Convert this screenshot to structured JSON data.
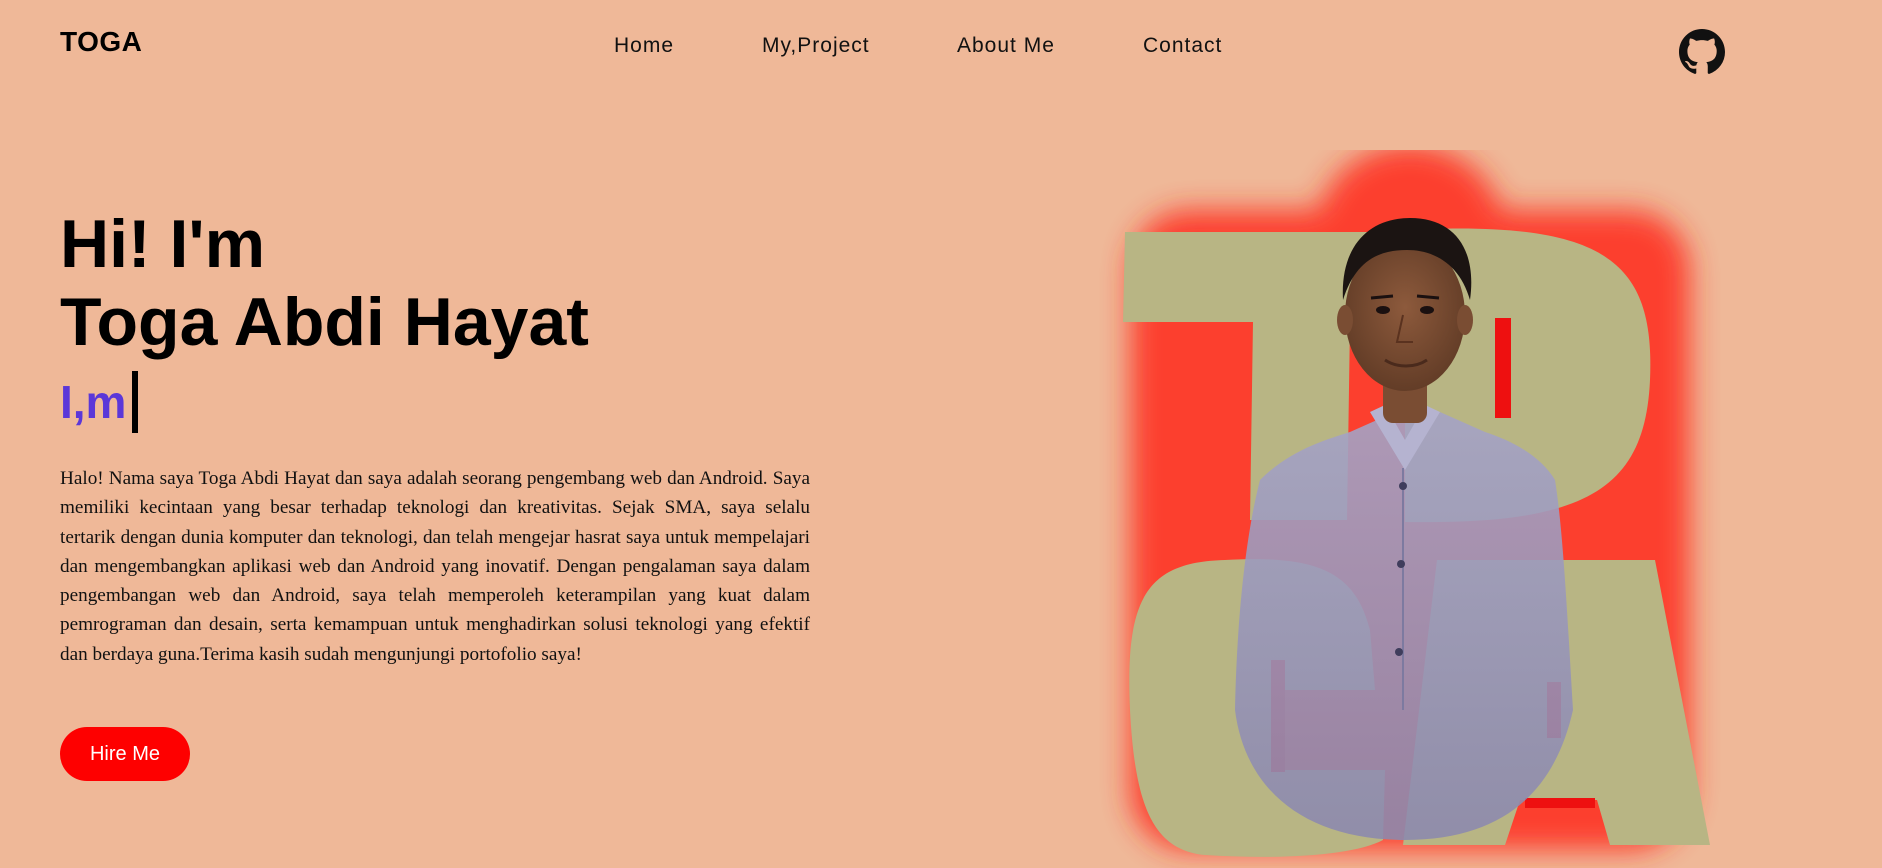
{
  "logo": "TOGA",
  "nav": {
    "items": [
      {
        "label": "Home"
      },
      {
        "label": "My,Project"
      },
      {
        "label": "About Me"
      },
      {
        "label": "Contact"
      }
    ],
    "github_icon": "github-icon"
  },
  "hero": {
    "greeting": "Hi! I'm",
    "name": "Toga Abdi Hayat",
    "typing_text": "I,m",
    "bio": "Halo! Nama saya Toga Abdi Hayat dan saya adalah seorang pengembang web dan Android. Saya memiliki kecintaan yang besar terhadap teknologi dan kreativitas. Sejak SMA, saya selalu tertarik dengan dunia komputer dan teknologi, dan telah mengejar hasrat saya untuk mempelajari dan mengembangkan aplikasi web dan Android yang inovatif. Dengan pengalaman saya dalam pengembangan web dan Android, saya telah memperoleh keterampilan yang kuat dalam pemrograman dan desain, serta kemampuan untuk menghadirkan solusi teknologi yang efektif dan berdaya guna.Terima kasih sudah mengunjungi portofolio saya!",
    "hire_button": "Hire Me",
    "art_letters": [
      "T",
      "O",
      "G",
      "A"
    ]
  },
  "colors": {
    "background": "#efb898",
    "accent": "#fe0000",
    "typing": "#5b37d8",
    "letter_fill": "#b8b584",
    "glow": "#ff2a1a"
  }
}
